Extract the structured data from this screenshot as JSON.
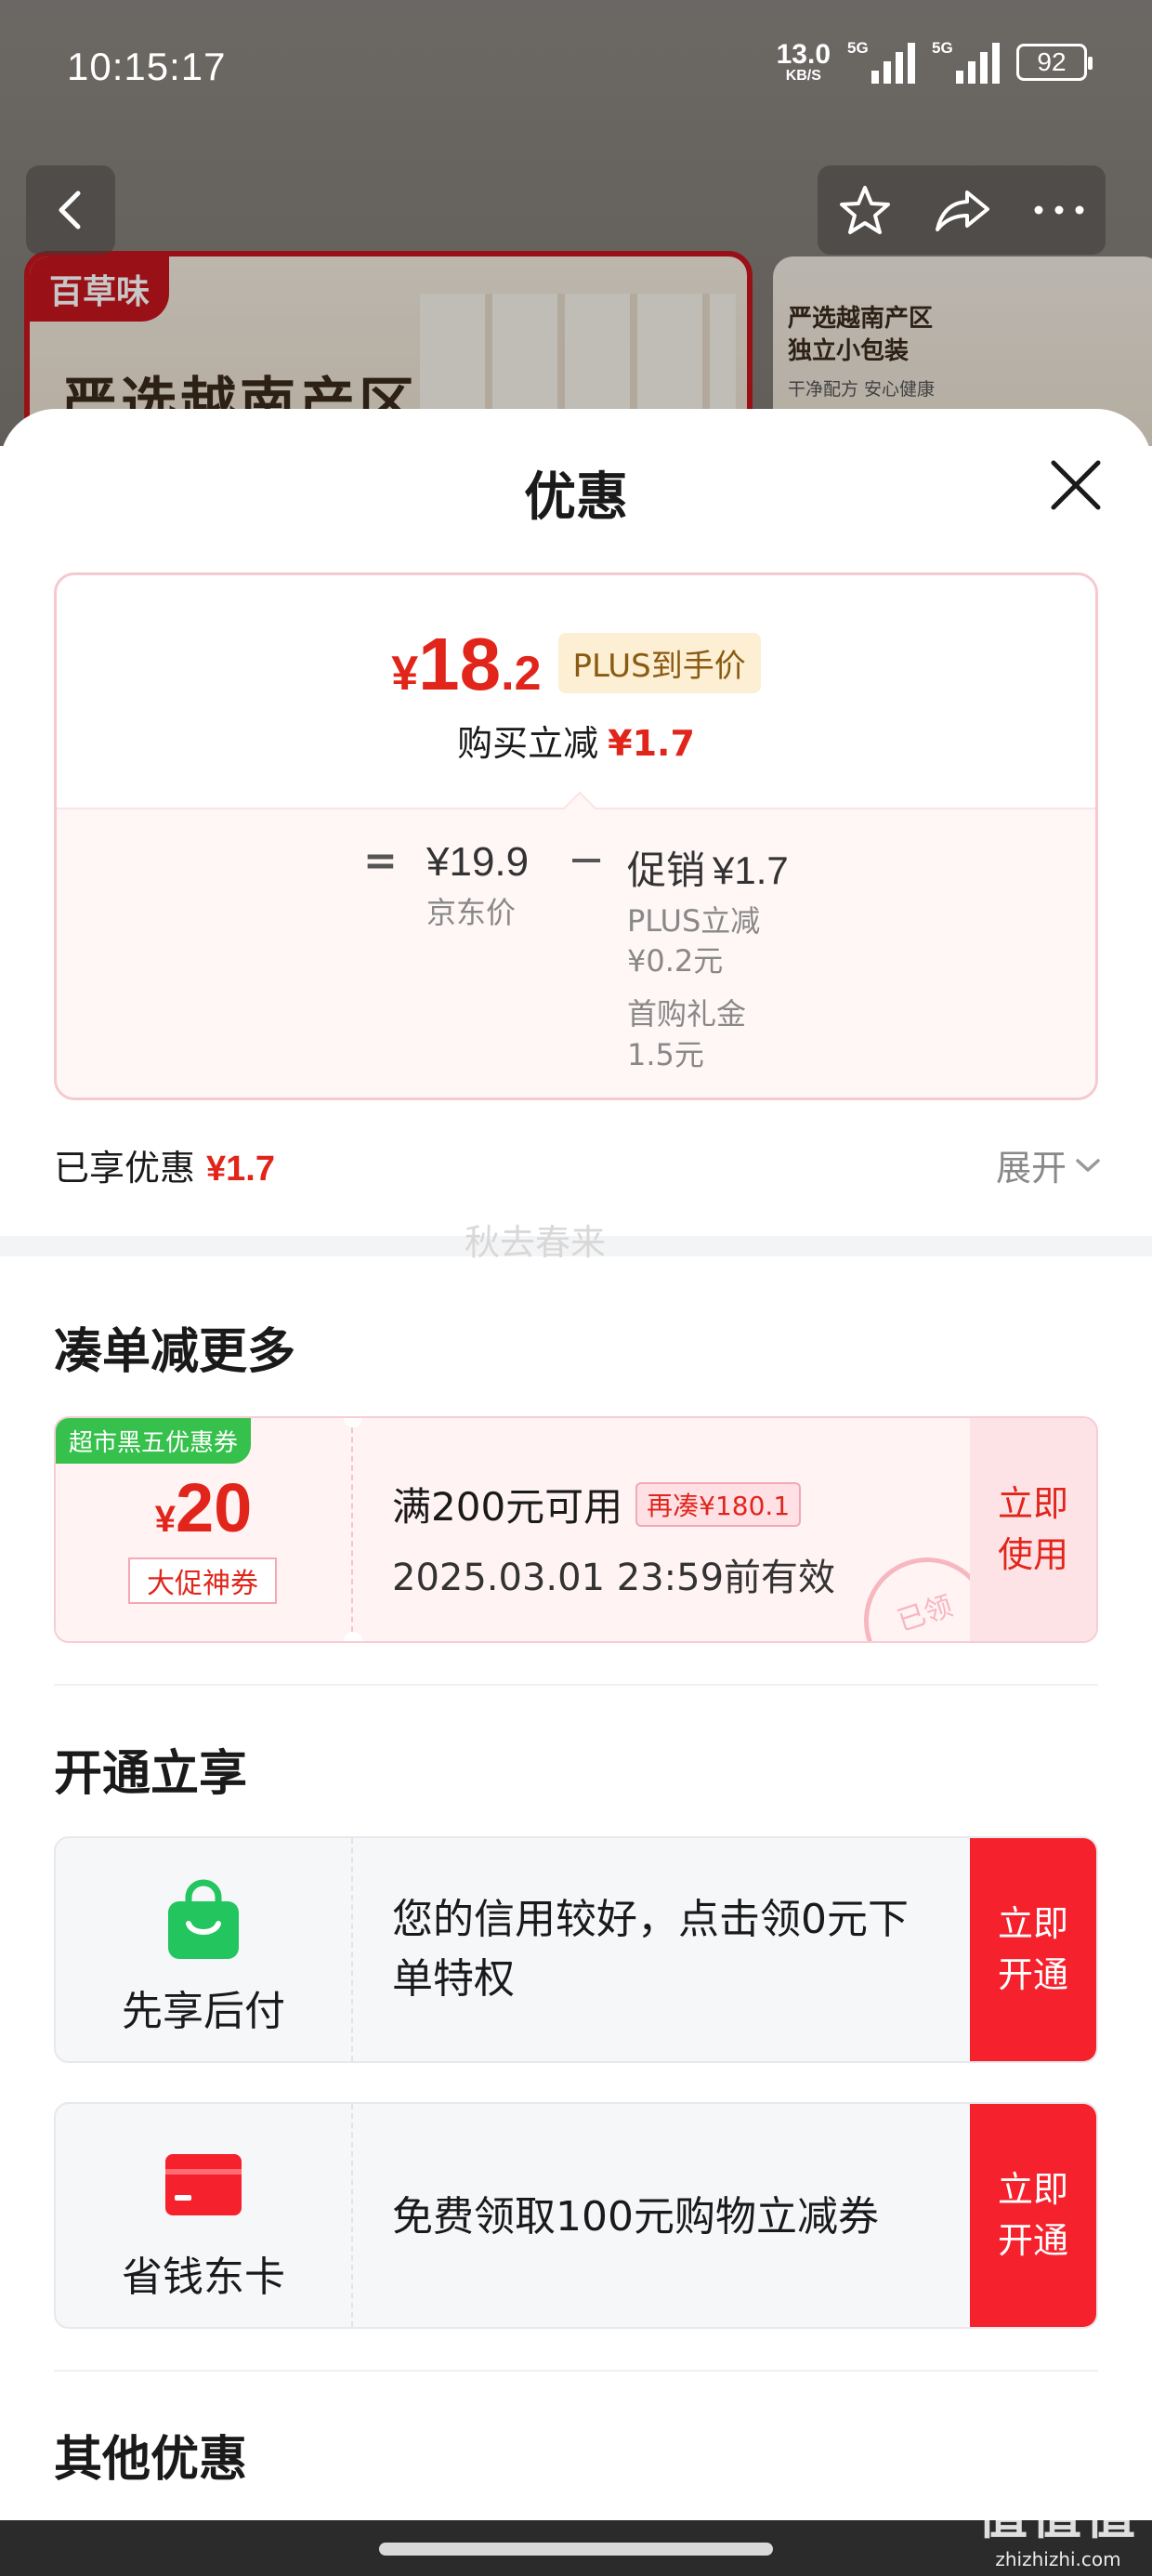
{
  "status_bar": {
    "time": "10:15:17",
    "net_speed_value": "13.0",
    "net_speed_unit": "KB/S",
    "signal1_tag": "5G",
    "signal2_tag": "5G",
    "battery": "92"
  },
  "background": {
    "banner_left_logo": "百草味",
    "banner_left_headline": "严选越南产区",
    "banner_right_title": "严选越南产区\n独立小包装",
    "banner_right_sub": "干净配方 安心健康"
  },
  "sheet": {
    "title": "优惠",
    "price": {
      "currency": "¥",
      "integer": "18",
      "decimal": ".2",
      "badge": "PLUS到手价",
      "reduce_label": "购买立减",
      "reduce_amount": "¥1.7",
      "eq": "=",
      "base_price": "¥19.9",
      "base_label": "京东价",
      "minus": "−",
      "promo_label": "促销",
      "promo_amount": "¥1.7",
      "promo_detail_1": "PLUS立减\n¥0.2元",
      "promo_detail_2": "首购礼金\n1.5元"
    },
    "enjoyed_label": "已享优惠",
    "enjoyed_amount": "¥1.7",
    "expand_label": "展开",
    "watermark": "秋去春来",
    "section_more": "凑单减更多",
    "coupon": {
      "tag": "超市黑五优惠券",
      "currency": "¥",
      "value": "20",
      "kind": "大促神券",
      "condition": "满200元可用",
      "extra": "再凑¥180.1",
      "valid": "2025.03.01 23:59前有效",
      "cta": "立即\n使用",
      "stamp": "已领"
    },
    "section_open": "开通立享",
    "services": [
      {
        "name": "先享后付",
        "desc": "您的信用较好，点击领0元下单特权",
        "cta": "立即\n开通"
      },
      {
        "name": "省钱东卡",
        "desc": "免费领取100元购物立减券",
        "cta": "立即\n开通"
      }
    ],
    "section_other": "其他优惠"
  },
  "site_watermark": {
    "big": "值值值",
    "small": "zhizhizhi.com"
  },
  "colors": {
    "accent_red": "#e1251b",
    "cta_red": "#f5222d",
    "coupon_green": "#35c14b",
    "pay_green": "#22c55e"
  }
}
